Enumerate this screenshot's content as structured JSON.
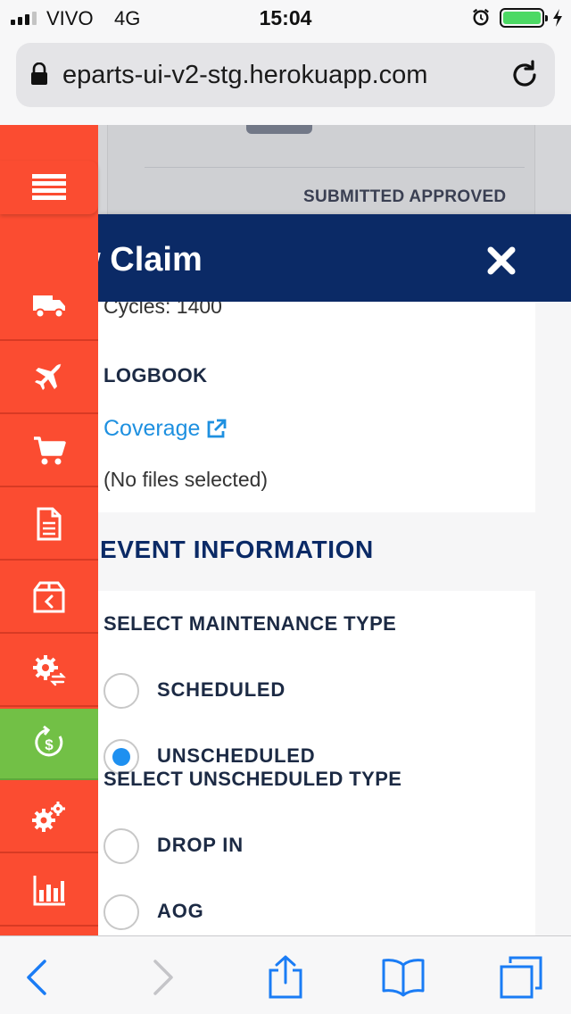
{
  "status_bar": {
    "carrier": "VIVO",
    "network": "4G",
    "time": "15:04"
  },
  "browser": {
    "url": "eparts-ui-v2-stg.herokuapp.com"
  },
  "background_page": {
    "status_text": "SUBMITTED APPROVED"
  },
  "modal": {
    "title": "ew Claim",
    "cycles_text": "Cycles: 1400",
    "logbook_label": "LOGBOOK",
    "coverage_link": "Coverage",
    "no_files_text": "(No files selected)",
    "section_title": "EVENT INFORMATION",
    "maintenance": {
      "label": "SELECT MAINTENANCE TYPE",
      "options": [
        {
          "label": "SCHEDULED",
          "selected": false
        },
        {
          "label": "UNSCHEDULED",
          "selected": true
        }
      ]
    },
    "unscheduled": {
      "label": "SELECT UNSCHEDULED TYPE",
      "options": [
        {
          "label": "DROP IN",
          "selected": false
        },
        {
          "label": "AOG",
          "selected": false
        }
      ]
    }
  },
  "sidebar": {
    "items": [
      {
        "icon": "truck-icon"
      },
      {
        "icon": "airplane-icon"
      },
      {
        "icon": "cart-icon"
      },
      {
        "icon": "document-icon"
      },
      {
        "icon": "return-box-icon"
      },
      {
        "icon": "gear-exchange-icon"
      },
      {
        "icon": "dollar-cycle-icon",
        "active": true
      },
      {
        "icon": "gears-icon"
      },
      {
        "icon": "bar-chart-icon"
      }
    ]
  },
  "colors": {
    "sidebar": "#fb4c31",
    "sidebar_active": "#72c046",
    "modal_header": "#0b2a66",
    "link": "#1e90e0",
    "radio_checked": "#1e90f0",
    "ios_blue": "#1a7cf5"
  }
}
